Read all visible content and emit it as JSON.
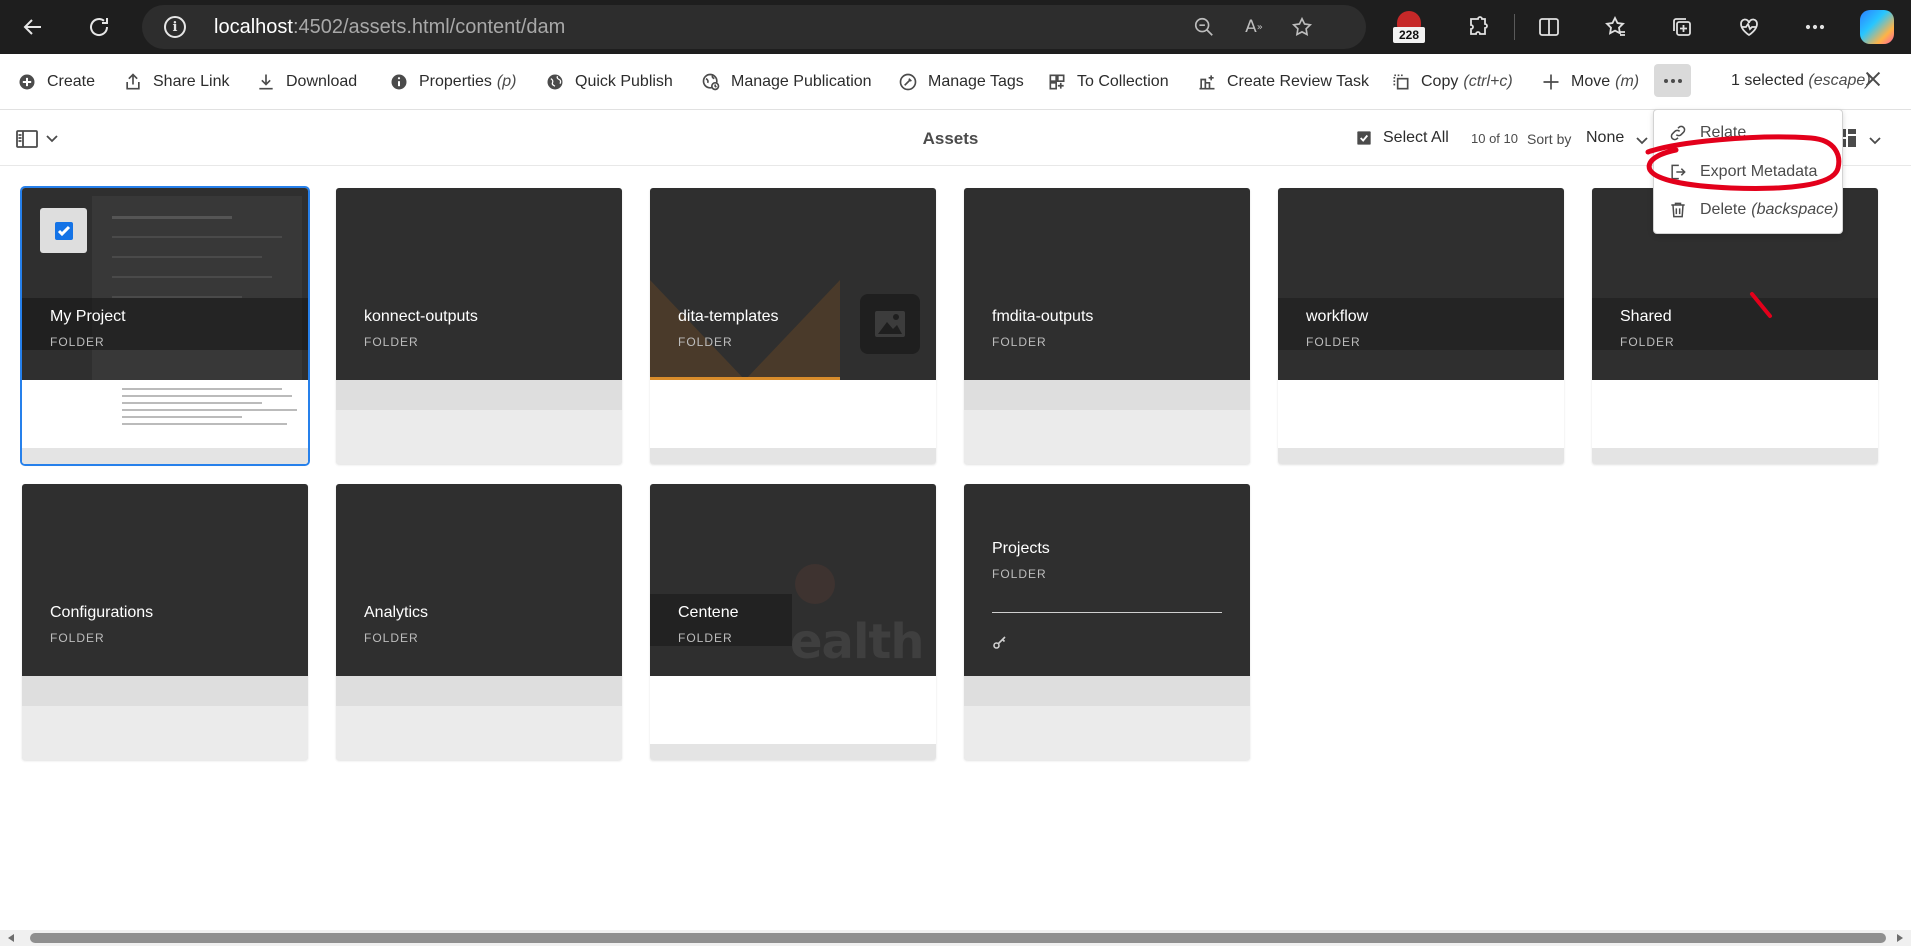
{
  "browser": {
    "url_host": "localhost",
    "url_path": ":4502/assets.html/content/dam",
    "extension_badge_count": "228"
  },
  "action_bar": {
    "items": [
      {
        "label": "Create",
        "icon": "plus-circle-icon",
        "key": ""
      },
      {
        "label": "Share Link",
        "icon": "share-icon",
        "key": ""
      },
      {
        "label": "Download",
        "icon": "download-icon",
        "key": ""
      },
      {
        "label": "Properties",
        "icon": "info-icon",
        "key": "(p)"
      },
      {
        "label": "Quick Publish",
        "icon": "globe-icon",
        "key": ""
      },
      {
        "label": "Manage Publication",
        "icon": "globe-clock-icon",
        "key": ""
      },
      {
        "label": "Manage Tags",
        "icon": "tag-icon",
        "key": ""
      },
      {
        "label": "To Collection",
        "icon": "collection-icon",
        "key": ""
      },
      {
        "label": "Create Review Task",
        "icon": "review-task-icon",
        "key": ""
      },
      {
        "label": "Copy",
        "icon": "copy-icon",
        "key": "(ctrl+c)"
      },
      {
        "label": "Move",
        "icon": "move-icon",
        "key": "(m)"
      }
    ],
    "selected_label": "1 selected",
    "selected_key": "(escape)"
  },
  "sub_header": {
    "title": "Assets",
    "select_all": "Select All",
    "count": "10 of 10",
    "sort_by_label": "Sort by",
    "sort_value": "None"
  },
  "more_menu": {
    "items": [
      {
        "label": "Relate",
        "key": "",
        "icon": "link-icon"
      },
      {
        "label": "Export Metadata",
        "key": "",
        "icon": "export-icon"
      },
      {
        "label": "Delete",
        "key": "(backspace)",
        "icon": "trash-icon"
      }
    ]
  },
  "cards": [
    {
      "title": "My Project",
      "type": "FOLDER",
      "selected": true
    },
    {
      "title": "konnect-outputs",
      "type": "FOLDER",
      "selected": false
    },
    {
      "title": "dita-templates",
      "type": "FOLDER",
      "selected": false
    },
    {
      "title": "fmdita-outputs",
      "type": "FOLDER",
      "selected": false
    },
    {
      "title": "workflow",
      "type": "FOLDER",
      "selected": false
    },
    {
      "title": "Shared",
      "type": "FOLDER",
      "selected": false
    },
    {
      "title": "Configurations",
      "type": "FOLDER",
      "selected": false
    },
    {
      "title": "Analytics",
      "type": "FOLDER",
      "selected": false
    },
    {
      "title": "Centene",
      "type": "FOLDER",
      "selected": false
    },
    {
      "title": "Projects",
      "type": "FOLDER",
      "selected": false
    }
  ],
  "colors": {
    "accent": "#1473e6",
    "annotation": "#e3001b",
    "card_dark": "#2f2f2f"
  }
}
